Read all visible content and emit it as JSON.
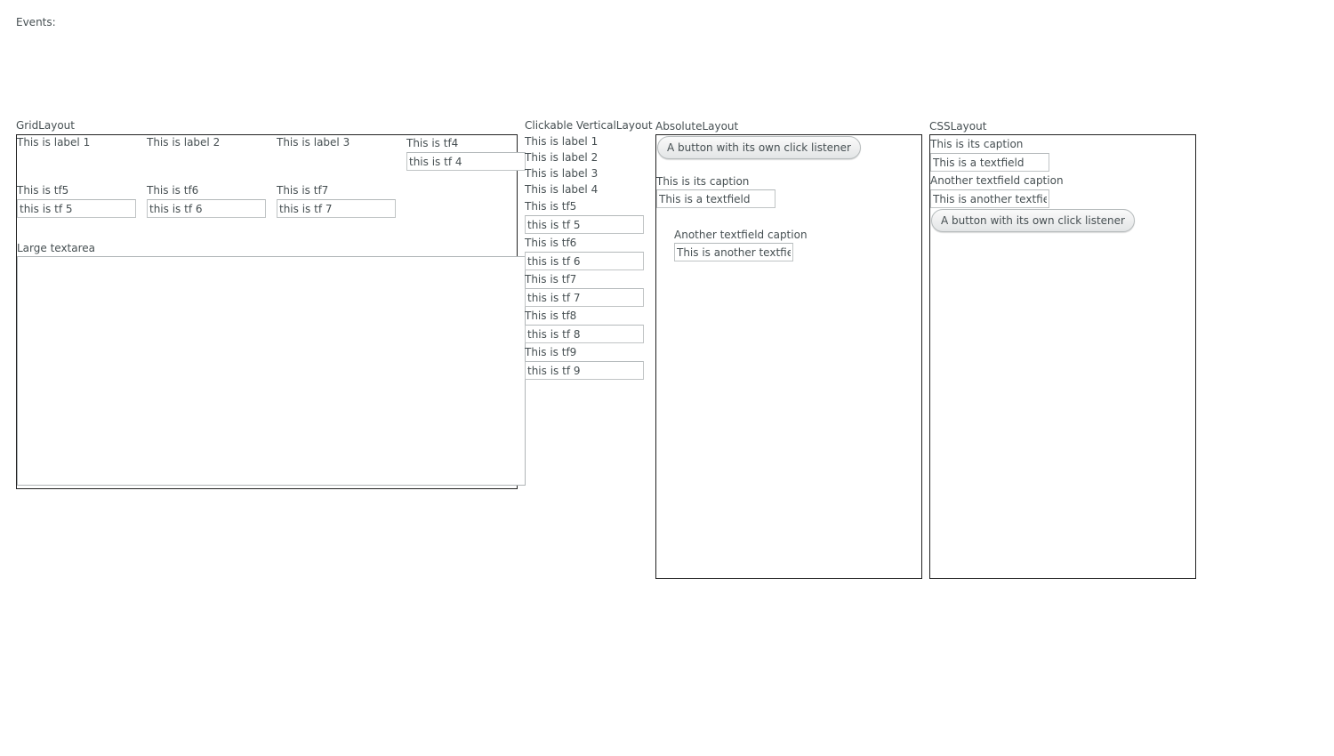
{
  "events_label": "Events:",
  "grid": {
    "caption": "GridLayout",
    "labels": [
      "This is label 1",
      "This is label 2",
      "This is label 3"
    ],
    "tf4_caption": "This is tf4",
    "tf4_value": "this is tf 4",
    "tf5_caption": "This is tf5",
    "tf5_value": "this is tf 5",
    "tf6_caption": "This is tf6",
    "tf6_value": "this is tf 6",
    "tf7_caption": "This is tf7",
    "tf7_value": "this is tf 7",
    "textarea_caption": "Large textarea",
    "textarea_value": ""
  },
  "vertical": {
    "caption": "Clickable VerticalLayout",
    "labels": [
      "This is label 1",
      "This is label 2",
      "This is label 3",
      "This is label 4"
    ],
    "fields": [
      {
        "caption": "This is tf5",
        "value": "this is tf 5"
      },
      {
        "caption": "This is tf6",
        "value": "this is tf 6"
      },
      {
        "caption": "This is tf7",
        "value": "this is tf 7"
      },
      {
        "caption": "This is tf8",
        "value": "this is tf 8"
      },
      {
        "caption": "This is tf9",
        "value": "this is tf 9"
      }
    ]
  },
  "absolute": {
    "caption": "AbsoluteLayout",
    "button_label": "A button with its own click listener",
    "tf1_caption": "This is its caption",
    "tf1_value": "This is a textfield",
    "tf2_caption": "Another textfield caption",
    "tf2_value": "This is another textfield"
  },
  "css": {
    "caption": "CSSLayout",
    "tf1_caption": "This is its caption",
    "tf1_value": "This is a textfield",
    "tf2_caption": "Another textfield caption",
    "tf2_value": "This is another textfield",
    "button_label": "A button with its own click listener"
  }
}
